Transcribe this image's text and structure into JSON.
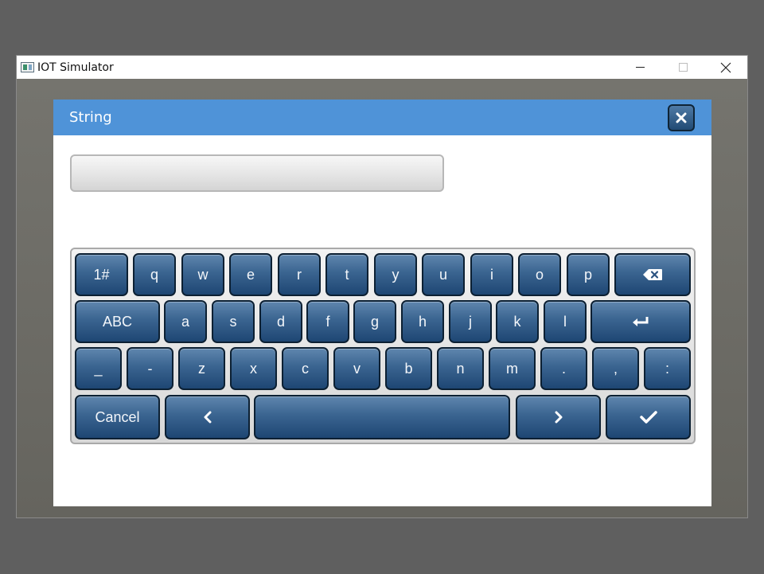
{
  "window": {
    "title": "IOT Simulator",
    "controls": {
      "minimize": "–",
      "maximize": "□",
      "close": "✕"
    }
  },
  "dialog": {
    "title": "String",
    "close_label": "✕",
    "input": {
      "value": "",
      "placeholder": ""
    }
  },
  "keyboard": {
    "row1": [
      "1#",
      "q",
      "w",
      "e",
      "r",
      "t",
      "y",
      "u",
      "i",
      "o",
      "p"
    ],
    "row2": [
      "ABC",
      "a",
      "s",
      "d",
      "f",
      "g",
      "h",
      "j",
      "k",
      "l"
    ],
    "row3": [
      "_",
      "-",
      "z",
      "x",
      "c",
      "v",
      "b",
      "n",
      "m",
      ".",
      ",",
      ":"
    ],
    "row4": {
      "cancel": "Cancel",
      "left": "‹",
      "space": "",
      "right": "›"
    },
    "icons": {
      "backspace": "backspace-icon",
      "enter": "enter-icon",
      "confirm": "checkmark-icon"
    }
  },
  "colors": {
    "header": "#4f93d8",
    "key_top": "#5f86ae",
    "key_bottom": "#1e4673"
  }
}
